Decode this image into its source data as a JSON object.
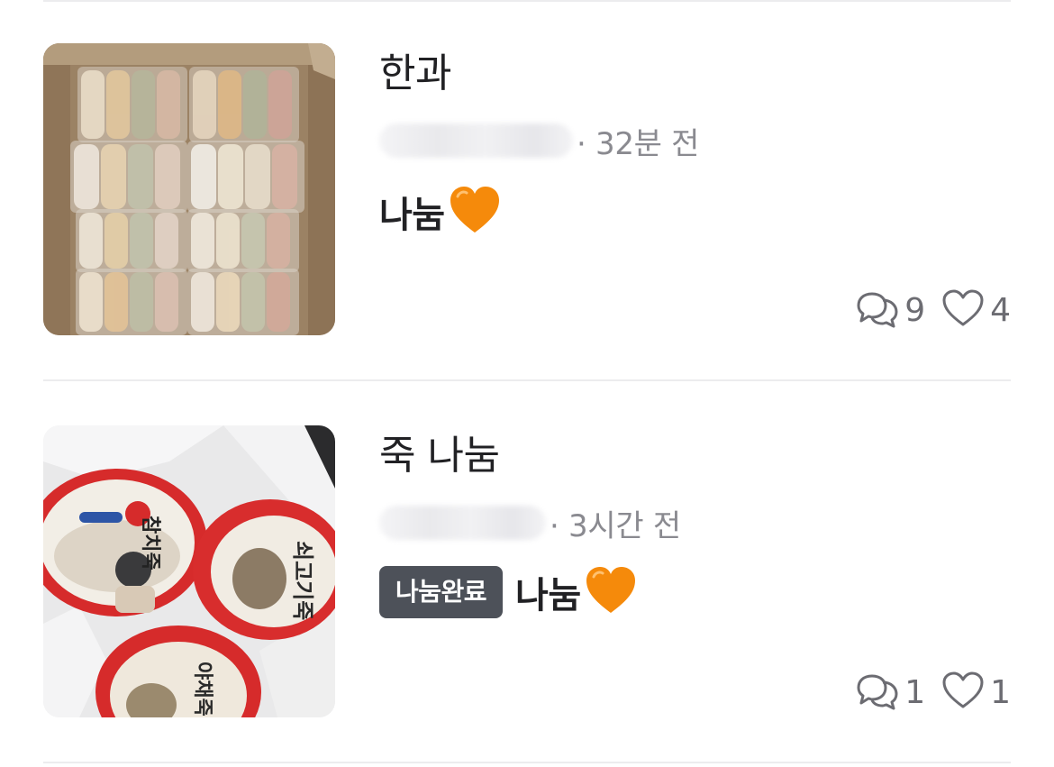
{
  "posts": [
    {
      "title": "한과",
      "time": "· 32분 전",
      "badge": "",
      "description": "나눔",
      "emoji": "orange-heart",
      "comments": "9",
      "likes": "4"
    },
    {
      "title": "죽 나눔",
      "time": "· 3시간 전",
      "badge": "나눔완료",
      "description": "나눔",
      "emoji": "orange-heart",
      "comments": "1",
      "likes": "1"
    }
  ],
  "colors": {
    "text": "#212124",
    "meta": "#8a8a90",
    "badge_bg": "#4d5159",
    "emoji_heart": "#f58a0b",
    "divider": "#ececee"
  }
}
